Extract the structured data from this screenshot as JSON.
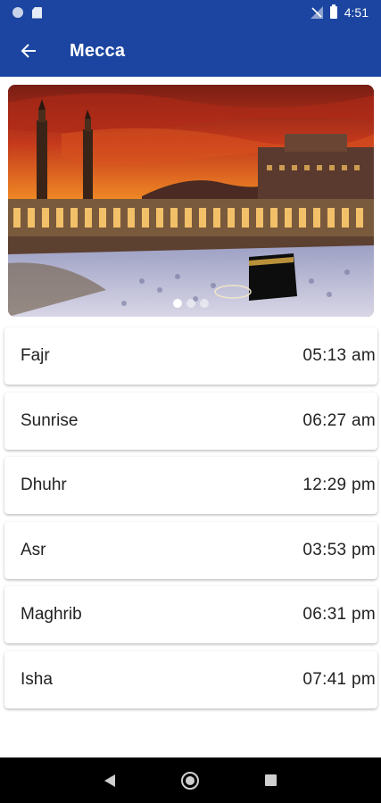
{
  "status_bar": {
    "time": "4:51",
    "icons": [
      "notification-dot-icon",
      "sd-card-icon",
      "no-signal-icon",
      "battery-icon"
    ]
  },
  "app_bar": {
    "title": "Mecca",
    "back_icon": "arrow-back-icon"
  },
  "hero": {
    "image": "kaaba-at-sunset",
    "carousel_dots": 3,
    "active_dot": 0
  },
  "prayers": [
    {
      "name": "Fajr",
      "time": "05:13 am"
    },
    {
      "name": "Sunrise",
      "time": "06:27 am"
    },
    {
      "name": "Dhuhr",
      "time": "12:29 pm"
    },
    {
      "name": "Asr",
      "time": "03:53 pm"
    },
    {
      "name": "Maghrib",
      "time": "06:31 pm"
    },
    {
      "name": "Isha",
      "time": "07:41 pm"
    }
  ],
  "nav_bar": {
    "icons": [
      "nav-back-icon",
      "nav-home-icon",
      "nav-recents-icon"
    ]
  },
  "colors": {
    "primary": "#1b45a0",
    "text": "#222222"
  }
}
